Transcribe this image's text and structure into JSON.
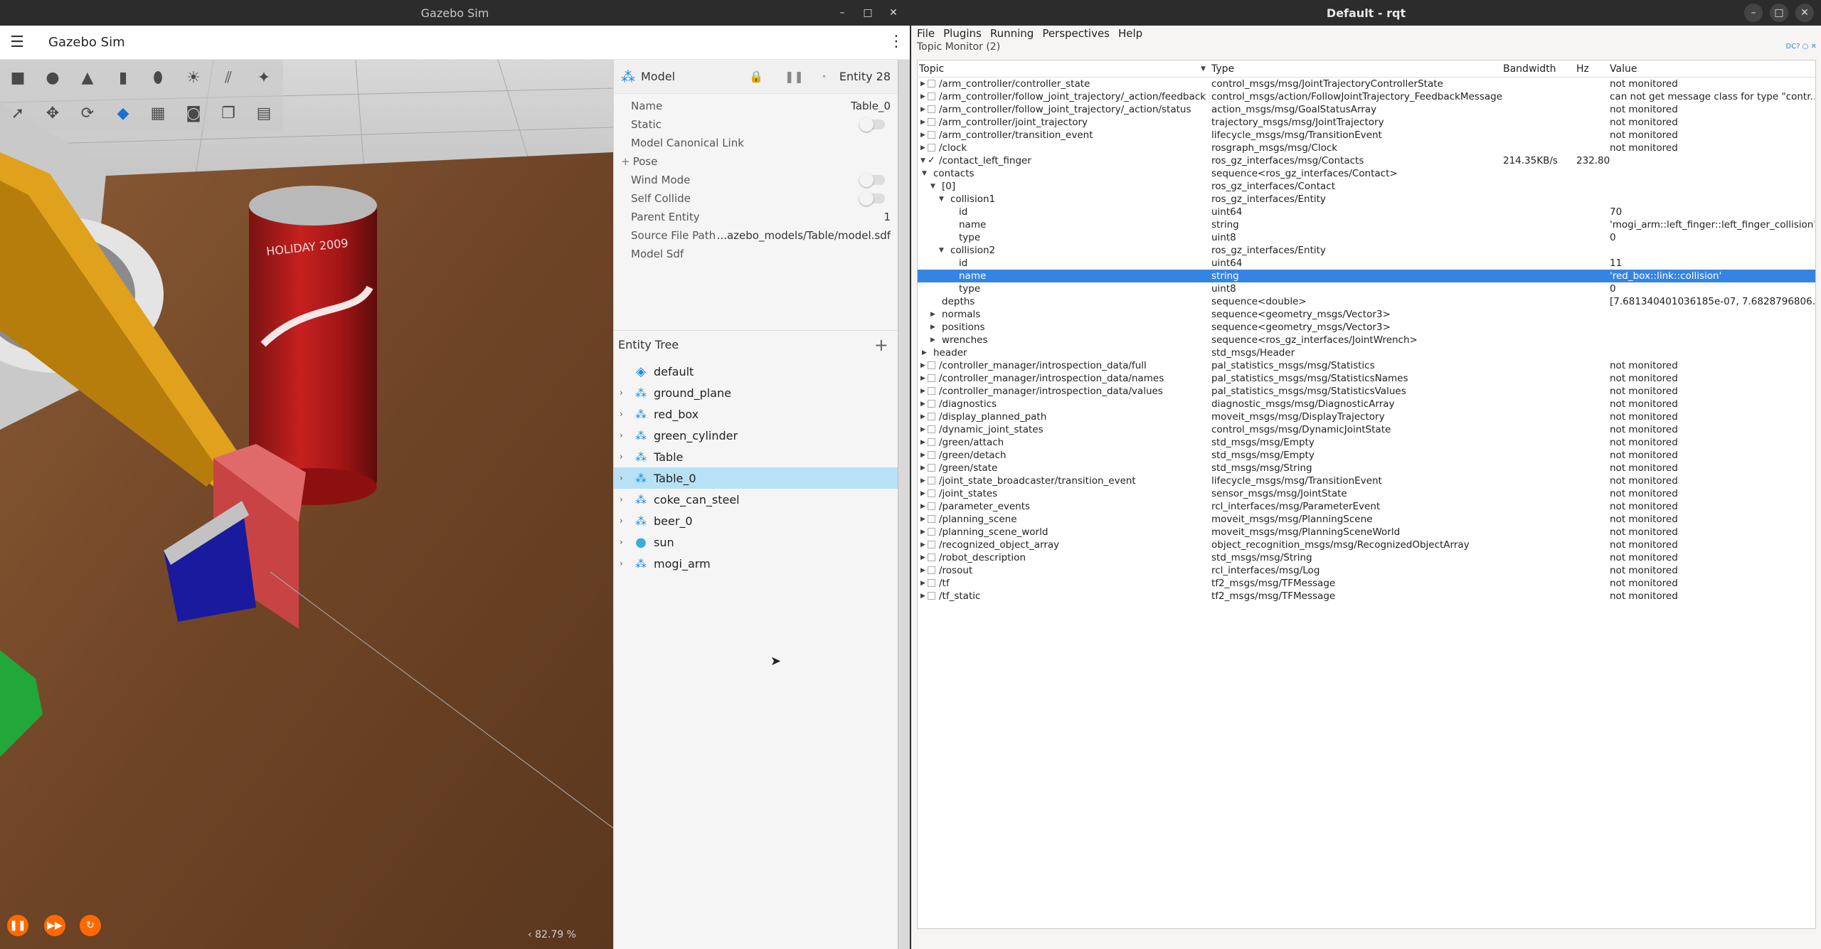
{
  "gazebo": {
    "window_title": "Gazebo Sim",
    "app_title": "Gazebo Sim",
    "toolbar_icons": [
      "box-icon",
      "sphere-icon",
      "cone-icon",
      "cylinder-icon",
      "capsule-icon",
      "sun-light-icon",
      "directional-light-icon",
      "spot-light-icon",
      "select-icon",
      "translate-icon",
      "rotate-icon",
      "snap-icon",
      "grid-icon",
      "camera-icon",
      "copy-icon",
      "paste-icon"
    ],
    "component": {
      "label": "Model",
      "entity": "Entity 28",
      "rows": [
        {
          "key": "Name",
          "value": "Table_0"
        },
        {
          "key": "Static",
          "value": ""
        },
        {
          "key": "Model Canonical Link",
          "value": ""
        },
        {
          "key": "Pose",
          "value": ""
        },
        {
          "key": "Wind Mode",
          "value": ""
        },
        {
          "key": "Self Collide",
          "value": ""
        },
        {
          "key": "Parent Entity",
          "value": "1"
        },
        {
          "key": "Source File Path",
          "value": "...azebo_models/Table/model.sdf"
        },
        {
          "key": "Model Sdf",
          "value": ""
        }
      ]
    },
    "entity_tree": {
      "title": "Entity Tree",
      "items": [
        "default",
        "ground_plane",
        "red_box",
        "green_cylinder",
        "Table",
        "Table_0",
        "coke_can_steel",
        "beer_0",
        "sun",
        "mogi_arm"
      ]
    },
    "zoom": "82.79 %",
    "scene_label": "HOLIDAY 2009"
  },
  "rqt": {
    "window_title": "Default - rqt",
    "menu": [
      "File",
      "Plugins",
      "Running",
      "Perspectives",
      "Help"
    ],
    "plugin_title": "Topic Monitor (2)",
    "columns": [
      "Topic",
      "Type",
      "Bandwidth",
      "Hz",
      "Value"
    ],
    "rows": [
      {
        "topic": "/arm_controller/controller_state",
        "type": "control_msgs/msg/JointTrajectoryControllerState",
        "bw": "",
        "hz": "",
        "value": "not monitored"
      },
      {
        "topic": "/arm_controller/follow_joint_trajectory/_action/feedback",
        "type": "control_msgs/action/FollowJointTrajectory_FeedbackMessage",
        "bw": "",
        "hz": "",
        "value": "can not get message class for type \"contr..."
      },
      {
        "topic": "/arm_controller/follow_joint_trajectory/_action/status",
        "type": "action_msgs/msg/GoalStatusArray",
        "bw": "",
        "hz": "",
        "value": "not monitored"
      },
      {
        "topic": "/arm_controller/joint_trajectory",
        "type": "trajectory_msgs/msg/JointTrajectory",
        "bw": "",
        "hz": "",
        "value": "not monitored"
      },
      {
        "topic": "/arm_controller/transition_event",
        "type": "lifecycle_msgs/msg/TransitionEvent",
        "bw": "",
        "hz": "",
        "value": "not monitored"
      },
      {
        "topic": "/clock",
        "type": "rosgraph_msgs/msg/Clock",
        "bw": "",
        "hz": "",
        "value": "not monitored"
      },
      {
        "topic": "/contact_left_finger",
        "type": "ros_gz_interfaces/msg/Contacts",
        "bw": "214.35KB/s",
        "hz": "232.80",
        "value": ""
      },
      {
        "topic": "contacts",
        "type": "sequence<ros_gz_interfaces/Contact>",
        "bw": "",
        "hz": "",
        "value": ""
      },
      {
        "topic": "[0]",
        "type": "ros_gz_interfaces/Contact",
        "bw": "",
        "hz": "",
        "value": ""
      },
      {
        "topic": "collision1",
        "type": "ros_gz_interfaces/Entity",
        "bw": "",
        "hz": "",
        "value": ""
      },
      {
        "topic": "id",
        "type": "uint64",
        "bw": "",
        "hz": "",
        "value": "70"
      },
      {
        "topic": "name",
        "type": "string",
        "bw": "",
        "hz": "",
        "value": "'mogi_arm::left_finger::left_finger_collision'"
      },
      {
        "topic": "type",
        "type": "uint8",
        "bw": "",
        "hz": "",
        "value": "0"
      },
      {
        "topic": "collision2",
        "type": "ros_gz_interfaces/Entity",
        "bw": "",
        "hz": "",
        "value": ""
      },
      {
        "topic": "id",
        "type": "uint64",
        "bw": "",
        "hz": "",
        "value": "11"
      },
      {
        "topic": "name",
        "type": "string",
        "bw": "",
        "hz": "",
        "value": "'red_box::link::collision'"
      },
      {
        "topic": "type",
        "type": "uint8",
        "bw": "",
        "hz": "",
        "value": "0"
      },
      {
        "topic": "depths",
        "type": "sequence<double>",
        "bw": "",
        "hz": "",
        "value": "[7.681340401036185e-07, 7.6828796806..."
      },
      {
        "topic": "normals",
        "type": "sequence<geometry_msgs/Vector3>",
        "bw": "",
        "hz": "",
        "value": ""
      },
      {
        "topic": "positions",
        "type": "sequence<geometry_msgs/Vector3>",
        "bw": "",
        "hz": "",
        "value": ""
      },
      {
        "topic": "wrenches",
        "type": "sequence<ros_gz_interfaces/JointWrench>",
        "bw": "",
        "hz": "",
        "value": ""
      },
      {
        "topic": "header",
        "type": "std_msgs/Header",
        "bw": "",
        "hz": "",
        "value": ""
      },
      {
        "topic": "/controller_manager/introspection_data/full",
        "type": "pal_statistics_msgs/msg/Statistics",
        "bw": "",
        "hz": "",
        "value": "not monitored"
      },
      {
        "topic": "/controller_manager/introspection_data/names",
        "type": "pal_statistics_msgs/msg/StatisticsNames",
        "bw": "",
        "hz": "",
        "value": "not monitored"
      },
      {
        "topic": "/controller_manager/introspection_data/values",
        "type": "pal_statistics_msgs/msg/StatisticsValues",
        "bw": "",
        "hz": "",
        "value": "not monitored"
      },
      {
        "topic": "/diagnostics",
        "type": "diagnostic_msgs/msg/DiagnosticArray",
        "bw": "",
        "hz": "",
        "value": "not monitored"
      },
      {
        "topic": "/display_planned_path",
        "type": "moveit_msgs/msg/DisplayTrajectory",
        "bw": "",
        "hz": "",
        "value": "not monitored"
      },
      {
        "topic": "/dynamic_joint_states",
        "type": "control_msgs/msg/DynamicJointState",
        "bw": "",
        "hz": "",
        "value": "not monitored"
      },
      {
        "topic": "/green/attach",
        "type": "std_msgs/msg/Empty",
        "bw": "",
        "hz": "",
        "value": "not monitored"
      },
      {
        "topic": "/green/detach",
        "type": "std_msgs/msg/Empty",
        "bw": "",
        "hz": "",
        "value": "not monitored"
      },
      {
        "topic": "/green/state",
        "type": "std_msgs/msg/String",
        "bw": "",
        "hz": "",
        "value": "not monitored"
      },
      {
        "topic": "/joint_state_broadcaster/transition_event",
        "type": "lifecycle_msgs/msg/TransitionEvent",
        "bw": "",
        "hz": "",
        "value": "not monitored"
      },
      {
        "topic": "/joint_states",
        "type": "sensor_msgs/msg/JointState",
        "bw": "",
        "hz": "",
        "value": "not monitored"
      },
      {
        "topic": "/parameter_events",
        "type": "rcl_interfaces/msg/ParameterEvent",
        "bw": "",
        "hz": "",
        "value": "not monitored"
      },
      {
        "topic": "/planning_scene",
        "type": "moveit_msgs/msg/PlanningScene",
        "bw": "",
        "hz": "",
        "value": "not monitored"
      },
      {
        "topic": "/planning_scene_world",
        "type": "moveit_msgs/msg/PlanningSceneWorld",
        "bw": "",
        "hz": "",
        "value": "not monitored"
      },
      {
        "topic": "/recognized_object_array",
        "type": "object_recognition_msgs/msg/RecognizedObjectArray",
        "bw": "",
        "hz": "",
        "value": "not monitored"
      },
      {
        "topic": "/robot_description",
        "type": "std_msgs/msg/String",
        "bw": "",
        "hz": "",
        "value": "not monitored"
      },
      {
        "topic": "/rosout",
        "type": "rcl_interfaces/msg/Log",
        "bw": "",
        "hz": "",
        "value": "not monitored"
      },
      {
        "topic": "/tf",
        "type": "tf2_msgs/msg/TFMessage",
        "bw": "",
        "hz": "",
        "value": "not monitored"
      },
      {
        "topic": "/tf_static",
        "type": "tf2_msgs/msg/TFMessage",
        "bw": "",
        "hz": "",
        "value": "not monitored"
      }
    ]
  },
  "colors": {
    "accent": "#ff6a00",
    "selection": "#3584e4",
    "tree_selection": "#b7e2f6",
    "entity_icon": "#1d8bd6"
  }
}
